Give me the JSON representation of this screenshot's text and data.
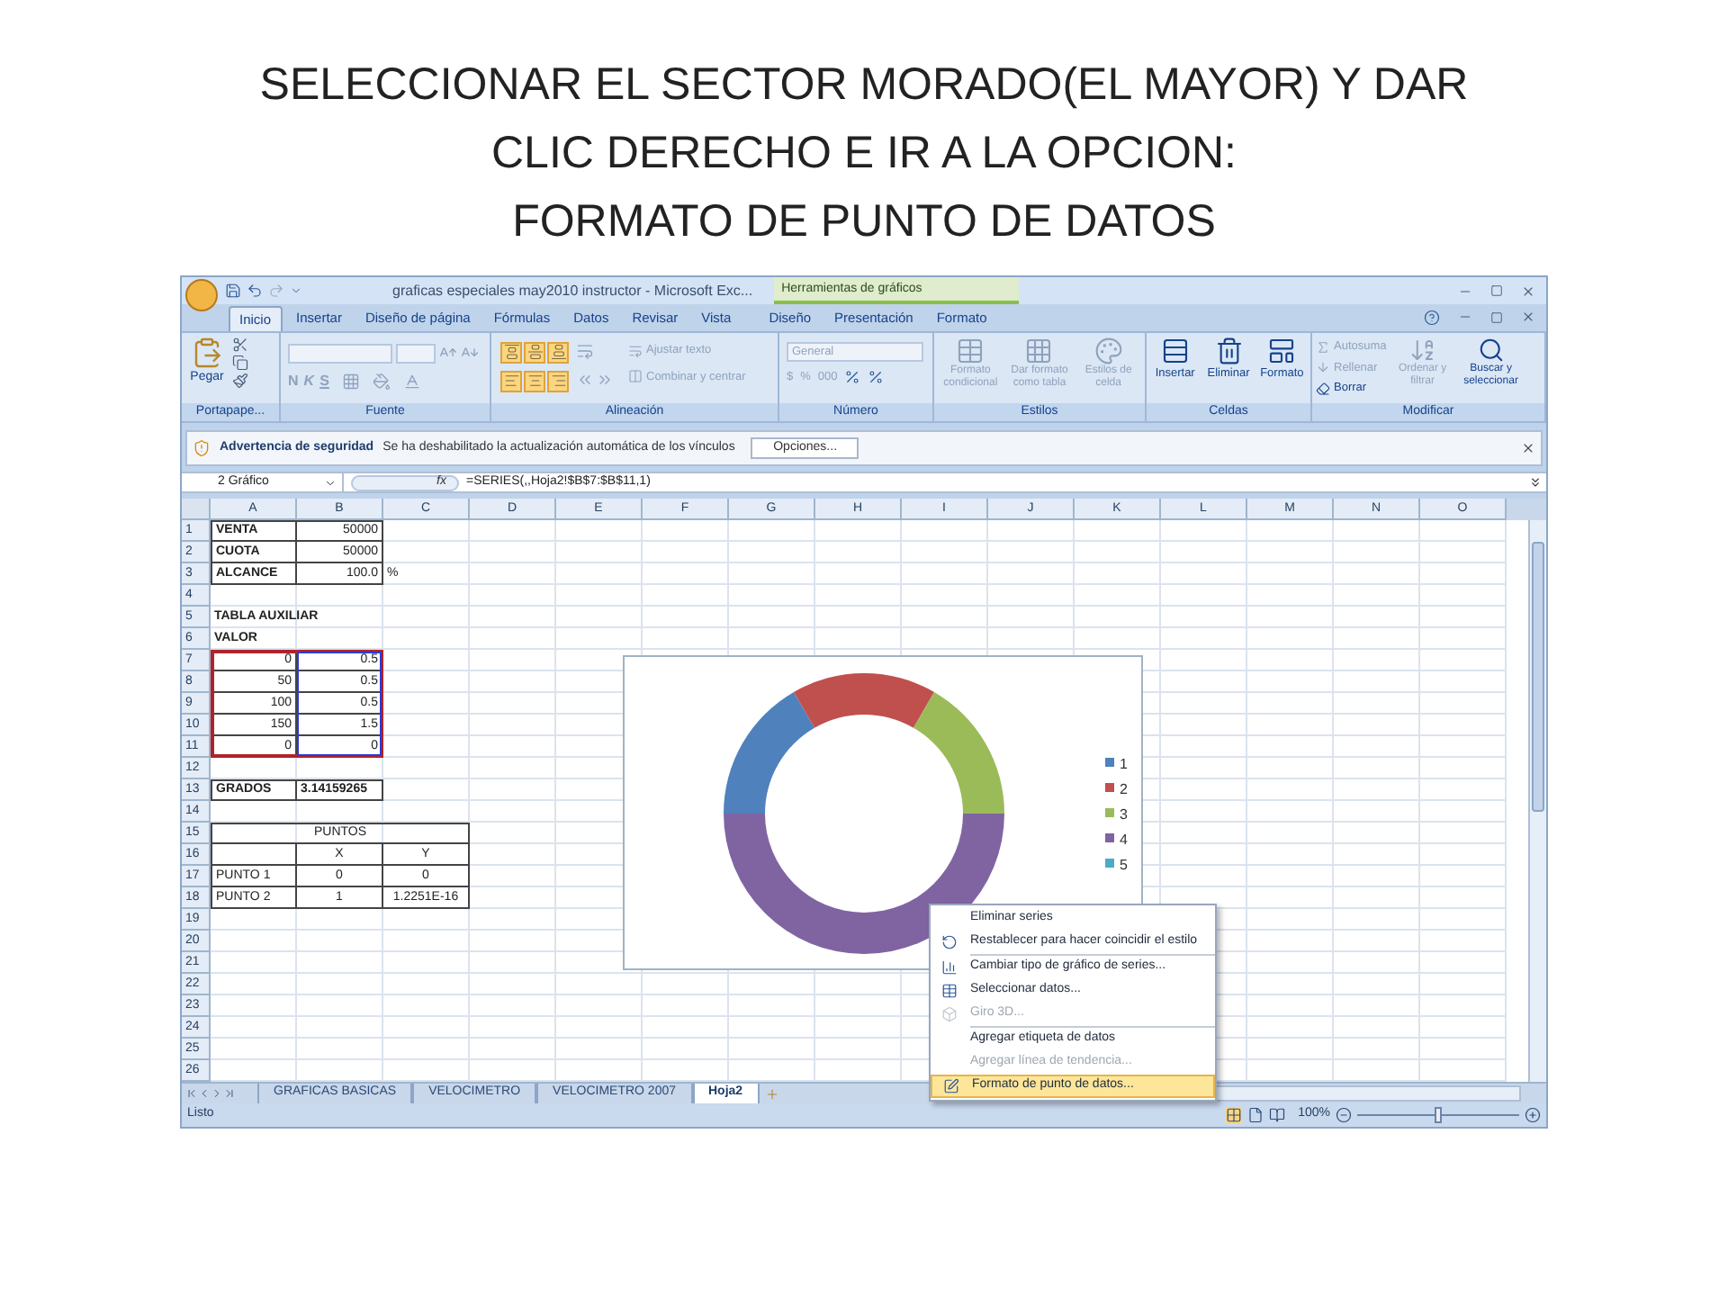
{
  "title_lines": [
    "SELECCIONAR EL SECTOR MORADO(EL MAYOR) Y DAR",
    "CLIC DERECHO E IR A LA OPCION:",
    "FORMATO DE PUNTO DE DATOS"
  ],
  "excel": {
    "window_title": "graficas especiales may2010 instructor - Microsoft Exc...",
    "context_tab_header": "Herramientas de gráficos",
    "tabs": [
      {
        "label": "Inicio",
        "selected": true
      },
      {
        "label": "Insertar",
        "selected": false
      },
      {
        "label": "Diseño de página",
        "selected": false
      },
      {
        "label": "Fórmulas",
        "selected": false
      },
      {
        "label": "Datos",
        "selected": false
      },
      {
        "label": "Revisar",
        "selected": false
      },
      {
        "label": "Vista",
        "selected": false
      },
      {
        "label": "Diseño",
        "selected": false
      },
      {
        "label": "Presentación",
        "selected": false
      },
      {
        "label": "Formato",
        "selected": false
      }
    ],
    "ribbon": {
      "clipboard": {
        "label": "Portapape...",
        "paste": "Pegar"
      },
      "font": {
        "label": "Fuente",
        "style_buttons": [
          "N",
          "K",
          "S"
        ]
      },
      "alignment": {
        "label": "Alineación",
        "vertical_align": [
          {
            "active": true
          },
          {
            "active": true
          },
          {
            "active": true
          }
        ],
        "horizontal_align": [
          {
            "active": true
          },
          {
            "active": true
          },
          {
            "active": true
          }
        ],
        "wrap": {
          "label": "Ajustar texto",
          "disabled": true
        },
        "merge": {
          "label": "Combinar y centrar",
          "disabled": true
        }
      },
      "number": {
        "label": "Número",
        "format": "General",
        "symbols": [
          "$",
          "%",
          "000"
        ]
      },
      "styles": {
        "label": "Estilos",
        "buttons": [
          {
            "label": "Formato condicional",
            "disabled": true
          },
          {
            "label": "Dar formato como tabla",
            "disabled": true
          },
          {
            "label": "Estilos de celda",
            "disabled": true
          }
        ]
      },
      "cells": {
        "label": "Celdas",
        "buttons": [
          {
            "label": "Insertar",
            "disabled": false
          },
          {
            "label": "Eliminar",
            "disabled": false
          },
          {
            "label": "Formato",
            "disabled": false
          }
        ]
      },
      "editing": {
        "label": "Modificar",
        "small": [
          {
            "label": "Autosuma",
            "disabled": true
          },
          {
            "label": "Rellenar",
            "disabled": true
          },
          {
            "label": "Borrar",
            "disabled": false
          }
        ],
        "large": [
          {
            "label": "Ordenar y filtrar",
            "disabled": true
          },
          {
            "label": "Buscar y seleccionar",
            "disabled": false
          }
        ]
      }
    },
    "security_bar": {
      "title": "Advertencia de seguridad",
      "message": "Se ha deshabilitado la actualización automática de los vínculos",
      "button": "Opciones..."
    },
    "formula_bar": {
      "name_box": "2 Gráfico",
      "fx": "fx",
      "formula": "=SERIES(,,Hoja2!$B$7:$B$11,1)"
    },
    "columns": [
      "A",
      "B",
      "C",
      "D",
      "E",
      "F",
      "G",
      "H",
      "I",
      "J",
      "K",
      "L",
      "M",
      "N",
      "O"
    ],
    "rows": [
      {
        "n": "1",
        "a": "VENTA",
        "b": "50000"
      },
      {
        "n": "2",
        "a": "CUOTA",
        "b": "50000"
      },
      {
        "n": "3",
        "a": "ALCANCE",
        "b": "100.0",
        "c": "%"
      },
      {
        "n": "4"
      },
      {
        "n": "5",
        "a": "TABLA AUXILIAR"
      },
      {
        "n": "6",
        "a": "VALOR"
      },
      {
        "n": "7",
        "a": "0",
        "b": "0.5"
      },
      {
        "n": "8",
        "a": "50",
        "b": "0.5"
      },
      {
        "n": "9",
        "a": "100",
        "b": "0.5"
      },
      {
        "n": "10",
        "a": "150",
        "b": "1.5"
      },
      {
        "n": "11",
        "a": "0",
        "b": "0"
      },
      {
        "n": "12"
      },
      {
        "n": "13",
        "a": "GRADOS",
        "b": "3.14159265"
      },
      {
        "n": "14"
      },
      {
        "n": "15",
        "a": "PUNTOS"
      },
      {
        "n": "16",
        "b": "X",
        "c": "Y"
      },
      {
        "n": "17",
        "a": "PUNTO 1",
        "b": "0",
        "c": "0"
      },
      {
        "n": "18",
        "a": "PUNTO 2",
        "b": "1",
        "c": "1.2251E-16"
      },
      {
        "n": "19"
      },
      {
        "n": "20"
      },
      {
        "n": "21"
      },
      {
        "n": "22"
      },
      {
        "n": "23"
      },
      {
        "n": "24"
      },
      {
        "n": "25"
      },
      {
        "n": "26"
      }
    ],
    "chart_data": {
      "type": "donut",
      "categories": [
        "1",
        "2",
        "3",
        "4",
        "5"
      ],
      "series": [
        {
          "values": [
            0.5,
            0.5,
            0.5,
            1.5,
            0
          ]
        }
      ],
      "colors": [
        "#4f81bd",
        "#c0504d",
        "#9bbb59",
        "#8064a2",
        "#4bacc6"
      ],
      "legend": "right"
    },
    "context_menu": [
      {
        "label": "Eliminar series",
        "icon": false,
        "disabled": false,
        "selected": false,
        "separator_above": false
      },
      {
        "label": "Restablecer para hacer coincidir el estilo",
        "icon": true,
        "disabled": false,
        "selected": false,
        "separator_above": false
      },
      {
        "label": "Cambiar tipo de gráfico de series...",
        "icon": true,
        "disabled": false,
        "selected": false,
        "separator_above": true
      },
      {
        "label": "Seleccionar datos...",
        "icon": true,
        "disabled": false,
        "selected": false,
        "separator_above": false
      },
      {
        "label": "Giro 3D...",
        "icon": true,
        "disabled": true,
        "selected": false,
        "separator_above": false
      },
      {
        "label": "Agregar etiqueta de datos",
        "icon": false,
        "disabled": false,
        "selected": false,
        "separator_above": true
      },
      {
        "label": "Agregar línea de tendencia...",
        "icon": false,
        "disabled": true,
        "selected": false,
        "separator_above": false
      },
      {
        "label": "Formato de punto de datos...",
        "icon": true,
        "disabled": false,
        "selected": true,
        "separator_above": false
      }
    ],
    "sheet_tabs": [
      {
        "label": "GRAFICAS BASICAS",
        "selected": false
      },
      {
        "label": "VELOCIMETRO",
        "selected": false
      },
      {
        "label": "VELOCIMETRO 2007",
        "selected": false
      },
      {
        "label": "Hoja2",
        "selected": true
      }
    ],
    "status": {
      "text": "Listo",
      "zoom": "100%",
      "level": 0.5
    }
  }
}
